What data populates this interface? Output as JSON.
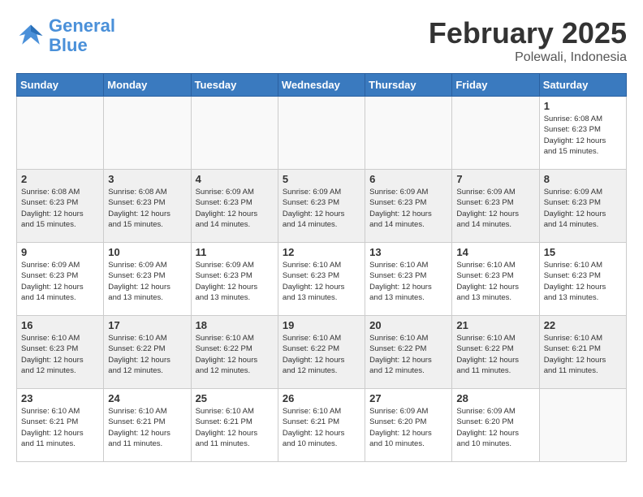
{
  "header": {
    "logo_line1": "General",
    "logo_line2": "Blue",
    "month_title": "February 2025",
    "location": "Polewali, Indonesia"
  },
  "weekdays": [
    "Sunday",
    "Monday",
    "Tuesday",
    "Wednesday",
    "Thursday",
    "Friday",
    "Saturday"
  ],
  "weeks": [
    [
      {
        "day": "",
        "info": ""
      },
      {
        "day": "",
        "info": ""
      },
      {
        "day": "",
        "info": ""
      },
      {
        "day": "",
        "info": ""
      },
      {
        "day": "",
        "info": ""
      },
      {
        "day": "",
        "info": ""
      },
      {
        "day": "1",
        "info": "Sunrise: 6:08 AM\nSunset: 6:23 PM\nDaylight: 12 hours\nand 15 minutes."
      }
    ],
    [
      {
        "day": "2",
        "info": "Sunrise: 6:08 AM\nSunset: 6:23 PM\nDaylight: 12 hours\nand 15 minutes."
      },
      {
        "day": "3",
        "info": "Sunrise: 6:08 AM\nSunset: 6:23 PM\nDaylight: 12 hours\nand 15 minutes."
      },
      {
        "day": "4",
        "info": "Sunrise: 6:09 AM\nSunset: 6:23 PM\nDaylight: 12 hours\nand 14 minutes."
      },
      {
        "day": "5",
        "info": "Sunrise: 6:09 AM\nSunset: 6:23 PM\nDaylight: 12 hours\nand 14 minutes."
      },
      {
        "day": "6",
        "info": "Sunrise: 6:09 AM\nSunset: 6:23 PM\nDaylight: 12 hours\nand 14 minutes."
      },
      {
        "day": "7",
        "info": "Sunrise: 6:09 AM\nSunset: 6:23 PM\nDaylight: 12 hours\nand 14 minutes."
      },
      {
        "day": "8",
        "info": "Sunrise: 6:09 AM\nSunset: 6:23 PM\nDaylight: 12 hours\nand 14 minutes."
      }
    ],
    [
      {
        "day": "9",
        "info": "Sunrise: 6:09 AM\nSunset: 6:23 PM\nDaylight: 12 hours\nand 14 minutes."
      },
      {
        "day": "10",
        "info": "Sunrise: 6:09 AM\nSunset: 6:23 PM\nDaylight: 12 hours\nand 13 minutes."
      },
      {
        "day": "11",
        "info": "Sunrise: 6:09 AM\nSunset: 6:23 PM\nDaylight: 12 hours\nand 13 minutes."
      },
      {
        "day": "12",
        "info": "Sunrise: 6:10 AM\nSunset: 6:23 PM\nDaylight: 12 hours\nand 13 minutes."
      },
      {
        "day": "13",
        "info": "Sunrise: 6:10 AM\nSunset: 6:23 PM\nDaylight: 12 hours\nand 13 minutes."
      },
      {
        "day": "14",
        "info": "Sunrise: 6:10 AM\nSunset: 6:23 PM\nDaylight: 12 hours\nand 13 minutes."
      },
      {
        "day": "15",
        "info": "Sunrise: 6:10 AM\nSunset: 6:23 PM\nDaylight: 12 hours\nand 13 minutes."
      }
    ],
    [
      {
        "day": "16",
        "info": "Sunrise: 6:10 AM\nSunset: 6:23 PM\nDaylight: 12 hours\nand 12 minutes."
      },
      {
        "day": "17",
        "info": "Sunrise: 6:10 AM\nSunset: 6:22 PM\nDaylight: 12 hours\nand 12 minutes."
      },
      {
        "day": "18",
        "info": "Sunrise: 6:10 AM\nSunset: 6:22 PM\nDaylight: 12 hours\nand 12 minutes."
      },
      {
        "day": "19",
        "info": "Sunrise: 6:10 AM\nSunset: 6:22 PM\nDaylight: 12 hours\nand 12 minutes."
      },
      {
        "day": "20",
        "info": "Sunrise: 6:10 AM\nSunset: 6:22 PM\nDaylight: 12 hours\nand 12 minutes."
      },
      {
        "day": "21",
        "info": "Sunrise: 6:10 AM\nSunset: 6:22 PM\nDaylight: 12 hours\nand 11 minutes."
      },
      {
        "day": "22",
        "info": "Sunrise: 6:10 AM\nSunset: 6:21 PM\nDaylight: 12 hours\nand 11 minutes."
      }
    ],
    [
      {
        "day": "23",
        "info": "Sunrise: 6:10 AM\nSunset: 6:21 PM\nDaylight: 12 hours\nand 11 minutes."
      },
      {
        "day": "24",
        "info": "Sunrise: 6:10 AM\nSunset: 6:21 PM\nDaylight: 12 hours\nand 11 minutes."
      },
      {
        "day": "25",
        "info": "Sunrise: 6:10 AM\nSunset: 6:21 PM\nDaylight: 12 hours\nand 11 minutes."
      },
      {
        "day": "26",
        "info": "Sunrise: 6:10 AM\nSunset: 6:21 PM\nDaylight: 12 hours\nand 10 minutes."
      },
      {
        "day": "27",
        "info": "Sunrise: 6:09 AM\nSunset: 6:20 PM\nDaylight: 12 hours\nand 10 minutes."
      },
      {
        "day": "28",
        "info": "Sunrise: 6:09 AM\nSunset: 6:20 PM\nDaylight: 12 hours\nand 10 minutes."
      },
      {
        "day": "",
        "info": ""
      }
    ]
  ]
}
